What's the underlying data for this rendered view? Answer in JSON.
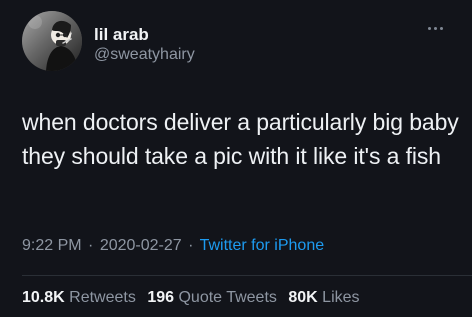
{
  "tweet": {
    "display_name": "lil arab",
    "handle": "@sweatyhairy",
    "text": "when doctors deliver a particularly big baby they should take a pic with it like it's a fish",
    "time": "9:22 PM",
    "date": "2020-02-27",
    "separator": "·",
    "source": "Twitter for iPhone"
  },
  "stats": {
    "retweets_count": "10.8K",
    "retweets_label": "Retweets",
    "quote_tweets_count": "196",
    "quote_tweets_label": "Quote Tweets",
    "likes_count": "80K",
    "likes_label": "Likes"
  },
  "icons": {
    "more": "more-options-icon"
  },
  "colors": {
    "background": "#12141a",
    "text": "#e9ecef",
    "secondary": "#8e96a2",
    "link": "#1d9bf0"
  }
}
